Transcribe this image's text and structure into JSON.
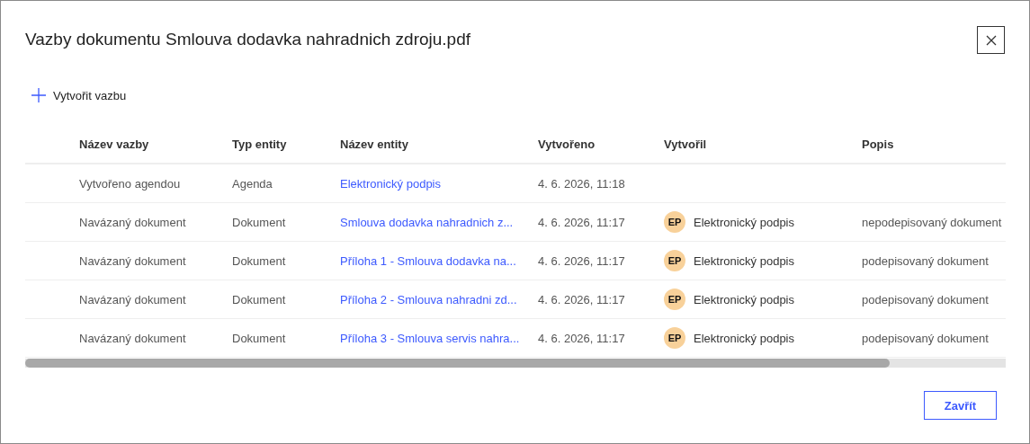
{
  "dialog": {
    "title": "Vazby dokumentu Smlouva dodavka nahradnich zdroju.pdf"
  },
  "toolbar": {
    "create_label": "Vytvořit vazbu"
  },
  "table": {
    "columns": [
      "Název vazby",
      "Typ entity",
      "Název entity",
      "Vytvořeno",
      "Vytvořil",
      "Popis"
    ],
    "rows": [
      {
        "link_name": "Vytvořeno agendou",
        "entity_type": "Agenda",
        "entity_name": "Elektronický podpis",
        "created": "4. 6. 2026, 11:18"
      },
      {
        "link_name": "Navázaný dokument",
        "entity_type": "Dokument",
        "entity_name": "Smlouva dodavka nahradnich z...",
        "created": "4. 6. 2026, 11:17",
        "creator_initials": "EP",
        "creator": "Elektronický podpis",
        "description": "nepodepisovaný dokument"
      },
      {
        "link_name": "Navázaný dokument",
        "entity_type": "Dokument",
        "entity_name": "Příloha 1 - Smlouva dodavka na...",
        "created": "4. 6. 2026, 11:17",
        "creator_initials": "EP",
        "creator": "Elektronický podpis",
        "description": "podepisovaný dokument"
      },
      {
        "link_name": "Navázaný dokument",
        "entity_type": "Dokument",
        "entity_name": "Příloha 2 - Smlouva nahradni zd...",
        "created": "4. 6. 2026, 11:17",
        "creator_initials": "EP",
        "creator": "Elektronický podpis",
        "description": "podepisovaný dokument"
      },
      {
        "link_name": "Navázaný dokument",
        "entity_type": "Dokument",
        "entity_name": "Příloha 3 - Smlouva servis nahra...",
        "created": "4. 6. 2026, 11:17",
        "creator_initials": "EP",
        "creator": "Elektronický podpis",
        "description": "podepisovaný dokument"
      }
    ]
  },
  "footer": {
    "close_label": "Zavřít"
  }
}
